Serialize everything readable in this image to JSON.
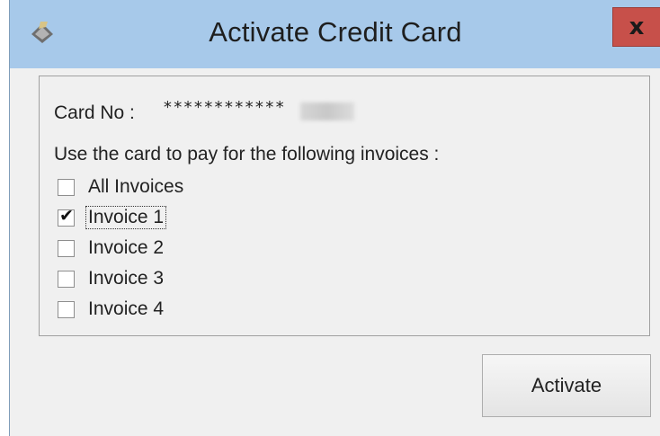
{
  "window": {
    "title": "Activate Credit Card",
    "close_label": "x"
  },
  "card": {
    "label": "Card No :",
    "masked_number": "************"
  },
  "instruction": "Use the card to pay for the following invoices :",
  "invoices": [
    {
      "label": "All Invoices",
      "checked": false
    },
    {
      "label": "Invoice 1",
      "checked": true
    },
    {
      "label": "Invoice 2",
      "checked": false
    },
    {
      "label": "Invoice 3",
      "checked": false
    },
    {
      "label": "Invoice 4",
      "checked": false
    }
  ],
  "buttons": {
    "activate": "Activate"
  },
  "colors": {
    "titlebar": "#a7c9ea",
    "close_button": "#c7504a",
    "client_background": "#f0f0f0"
  }
}
